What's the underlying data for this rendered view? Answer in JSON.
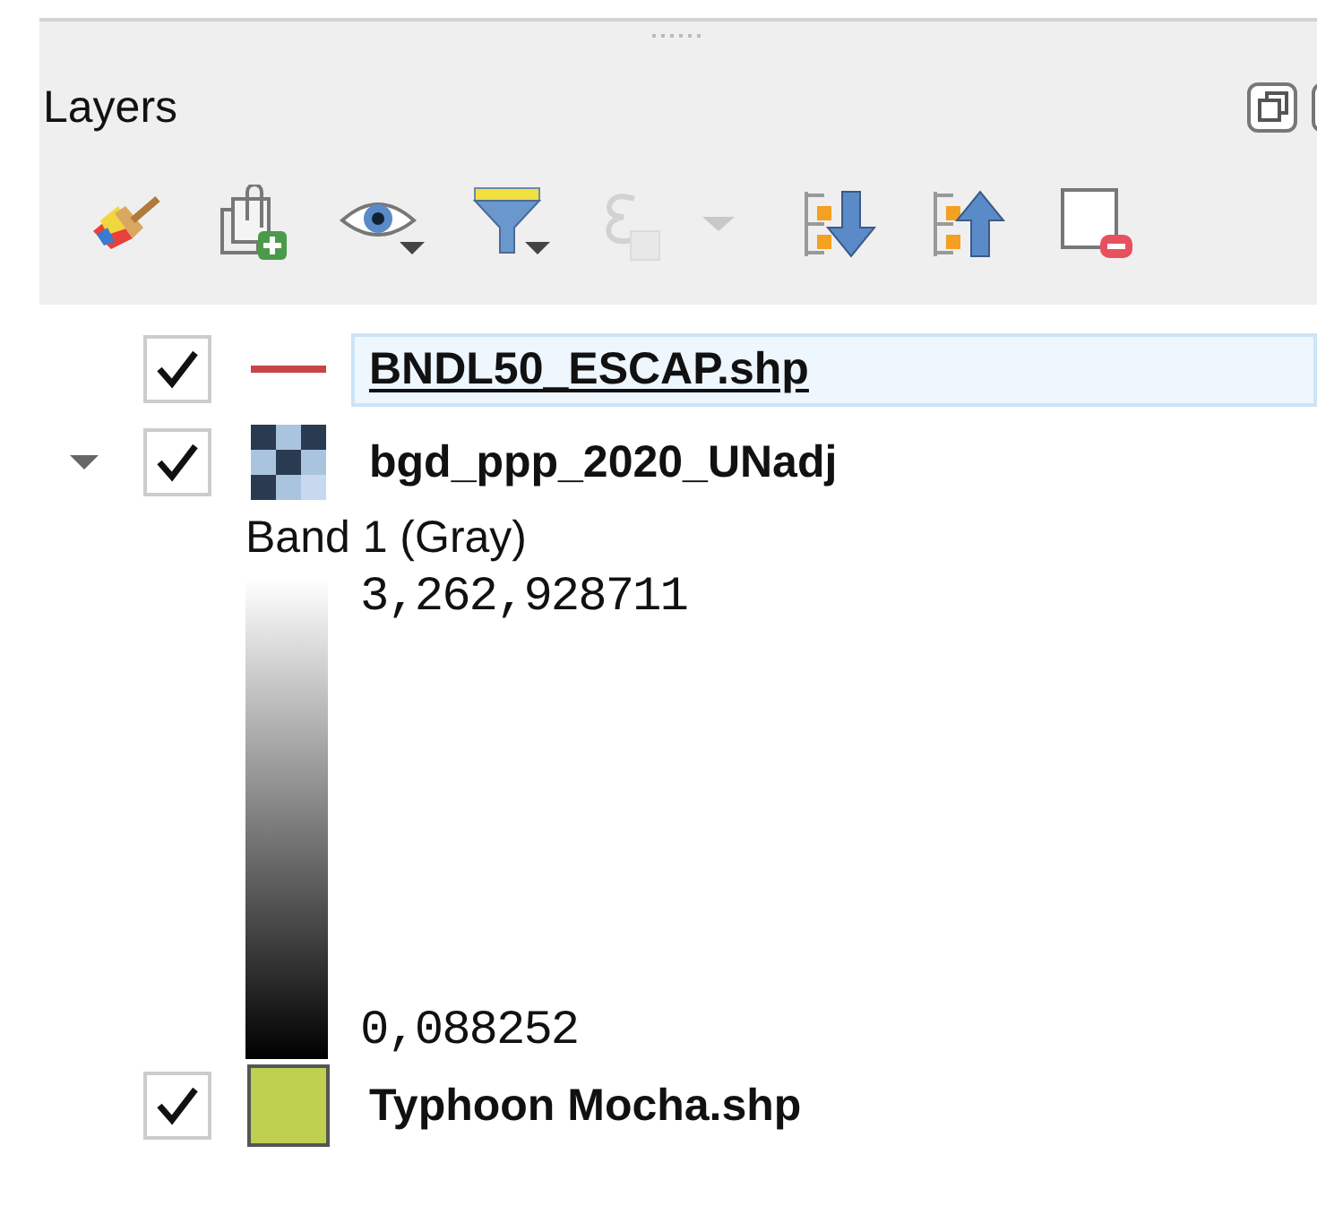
{
  "panel": {
    "title": "Layers"
  },
  "toolbar": [
    {
      "kind": "style",
      "disabled": false
    },
    {
      "kind": "add-group",
      "disabled": false
    },
    {
      "kind": "visibility",
      "disabled": false
    },
    {
      "kind": "filter",
      "disabled": false
    },
    {
      "kind": "expression-filter",
      "disabled": true
    },
    {
      "kind": "expand-all",
      "disabled": false
    },
    {
      "kind": "collapse-all",
      "disabled": false
    },
    {
      "kind": "remove",
      "disabled": false
    }
  ],
  "layers": [
    {
      "name": "BNDL50_ESCAP.shp",
      "kind": "line",
      "checked": true,
      "selected": true,
      "color": "#c8454a"
    },
    {
      "name": "bgd_ppp_2020_UNadj",
      "kind": "raster",
      "checked": true,
      "selected": false,
      "expanded": true,
      "legend": {
        "band": "Band 1 (Gray)",
        "max": "3,262,928711",
        "min": "0,088252"
      }
    },
    {
      "name": "Typhoon Mocha.shp",
      "kind": "polygon",
      "checked": true,
      "selected": false,
      "color": "#bfcf50"
    }
  ]
}
